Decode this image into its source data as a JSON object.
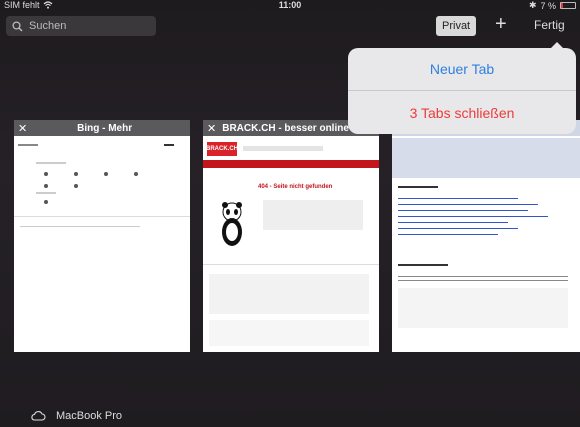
{
  "status": {
    "carrier": "SIM fehlt",
    "time": "11:00",
    "battery": "7 %"
  },
  "toolbar": {
    "search_placeholder": "Suchen",
    "private_label": "Privat",
    "new_tab_symbol": "+",
    "done_label": "Fertig"
  },
  "popover": {
    "new_tab": "Neuer Tab",
    "close_tabs": "3 Tabs schließen"
  },
  "tabs": [
    {
      "title": "Bing - Mehr"
    },
    {
      "title": "BRACK.CH - besser online einkaufen"
    },
    {
      "title": ""
    }
  ],
  "brack": {
    "logo": "BRACK.CH",
    "error": "404 - Seite nicht gefunden"
  },
  "device": {
    "name": "MacBook Pro"
  },
  "colors": {
    "accent_blue": "#2f7fe0",
    "destructive_red": "#ee3a3a",
    "brand_red": "#d8232a"
  }
}
